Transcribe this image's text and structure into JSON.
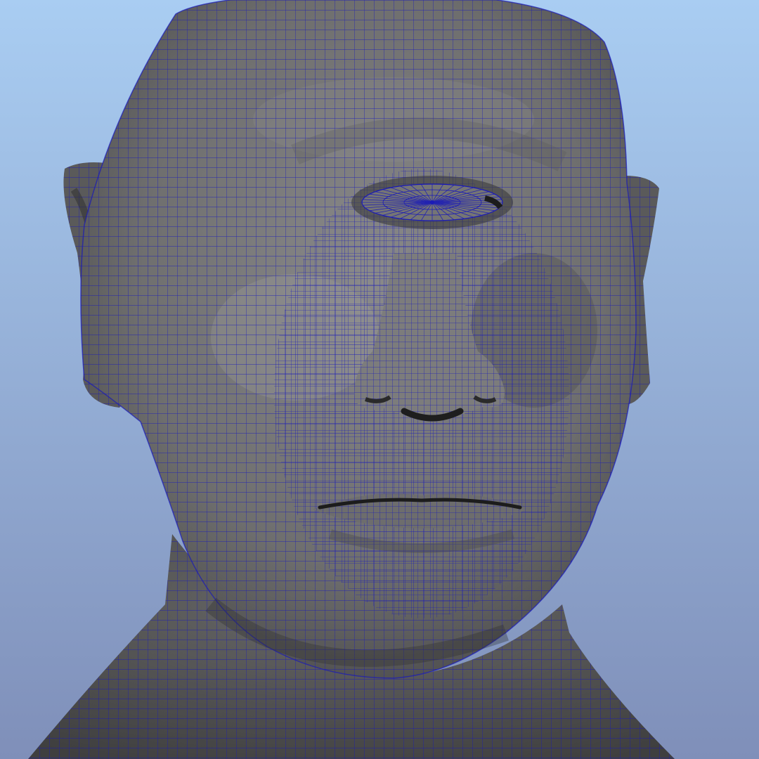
{
  "viewport": {
    "background_top": "#a9cdf2",
    "background_bottom": "#7f8fb9"
  },
  "model": {
    "shading_color": "#6c6c6c",
    "wireframe_color": "#1a1ab8",
    "features": [
      "head",
      "single-eye",
      "nose",
      "mouth",
      "ears",
      "neck"
    ]
  }
}
